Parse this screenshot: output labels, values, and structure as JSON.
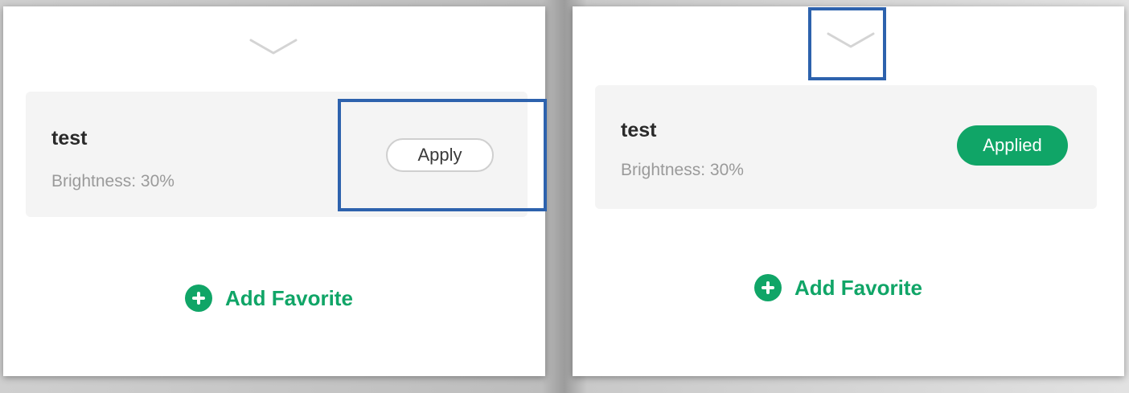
{
  "colors": {
    "accent_green": "#10a567",
    "highlight_blue": "#2d62ad",
    "card_background": "#f4f4f4"
  },
  "panels": [
    {
      "state": "before",
      "collapse_icon": "chevron-down-icon",
      "favorite": {
        "title": "test",
        "detail": "Brightness: 30%",
        "button_label": "Apply"
      },
      "add_favorite_label": "Add Favorite",
      "add_icon": "plus-circle-icon"
    },
    {
      "state": "after",
      "collapse_icon": "chevron-down-icon",
      "favorite": {
        "title": "test",
        "detail": "Brightness: 30%",
        "button_label": "Applied"
      },
      "add_favorite_label": "Add Favorite",
      "add_icon": "plus-circle-icon"
    }
  ]
}
